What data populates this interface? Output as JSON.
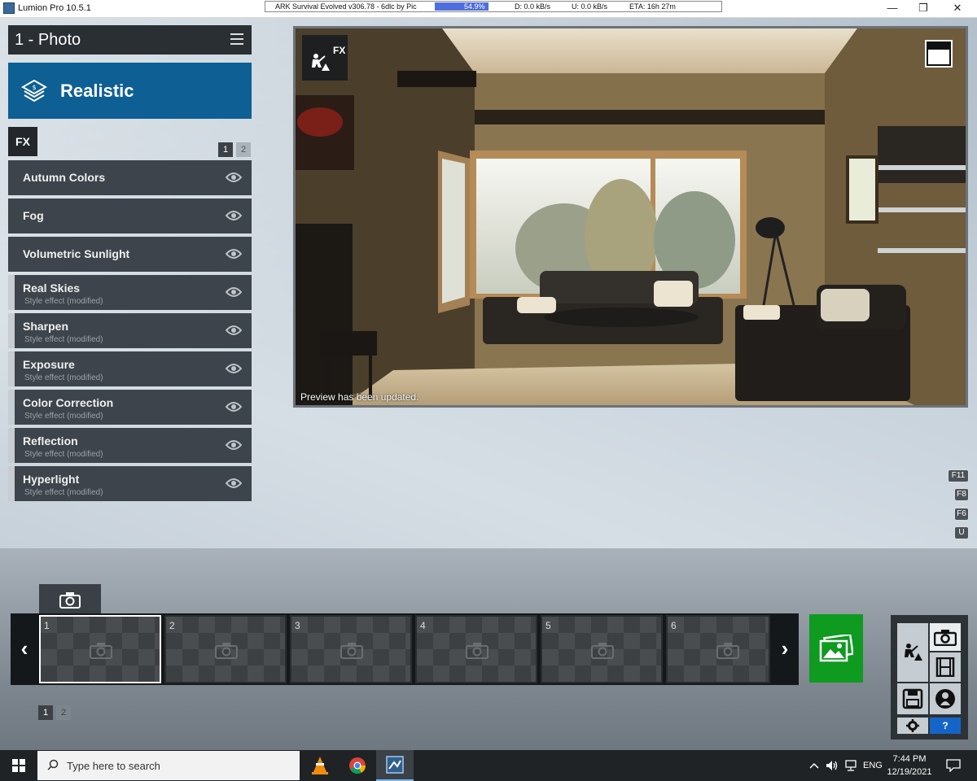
{
  "window": {
    "title": "Lumion Pro 10.5.1",
    "minimize_glyph": "—",
    "maximize_glyph": "❐",
    "close_glyph": "✕"
  },
  "download_bar": {
    "name": "ARK Survival Evolved v306.78 - 6dlc by Pic",
    "progress_percent": 54.9,
    "progress_label": "54.9%",
    "download_speed": "D: 0.0 kB/s",
    "upload_speed": "U: 0.0 kB/s",
    "eta": "ETA: 16h 27m"
  },
  "header": {
    "title": "1 - Photo",
    "menu_icon": "hamburger-icon"
  },
  "style_banner": {
    "label": "Realistic",
    "icon": "layers-icon",
    "color": "#0d5f94"
  },
  "fx_panel": {
    "tab_label": "FX",
    "pages": [
      "1",
      "2"
    ],
    "current_page": "1",
    "items": [
      {
        "name": "Autumn Colors",
        "subtitle": "",
        "styled": false
      },
      {
        "name": "Fog",
        "subtitle": "",
        "styled": false
      },
      {
        "name": "Volumetric Sunlight",
        "subtitle": "",
        "styled": false
      },
      {
        "name": "Real Skies",
        "subtitle": "Style effect (modified)",
        "styled": true
      },
      {
        "name": "Sharpen",
        "subtitle": "Style effect (modified)",
        "styled": true
      },
      {
        "name": "Exposure",
        "subtitle": "Style effect (modified)",
        "styled": true
      },
      {
        "name": "Color Correction",
        "subtitle": "Style effect (modified)",
        "styled": true
      },
      {
        "name": "Reflection",
        "subtitle": "Style effect (modified)",
        "styled": true
      },
      {
        "name": "Hyperlight",
        "subtitle": "Style effect (modified)",
        "styled": true
      }
    ]
  },
  "preview": {
    "fx_badge": "FX",
    "status": "Preview has been updated."
  },
  "hotkeys": [
    "F11",
    "F8",
    "F6",
    "U"
  ],
  "filmstrip": {
    "prev_glyph": "‹",
    "next_glyph": "›",
    "slots": [
      "1",
      "2",
      "3",
      "4",
      "5",
      "6"
    ],
    "selected_slot": "1",
    "pages": [
      "1",
      "2"
    ],
    "current_page": "1",
    "render_color": "#0f9a20"
  },
  "modes": {
    "help_label": "?",
    "help_color": "#1565c8"
  },
  "taskbar": {
    "search_placeholder": "Type here to search",
    "language": "ENG",
    "time": "7:44 PM",
    "date": "12/19/2021"
  }
}
